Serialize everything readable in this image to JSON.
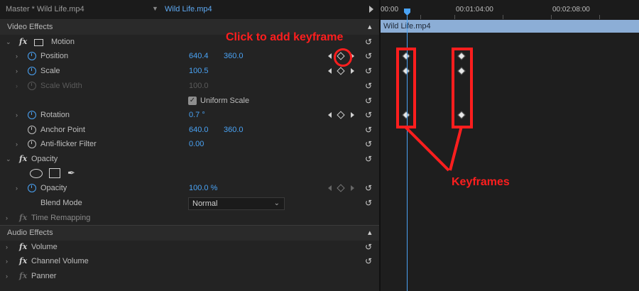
{
  "header": {
    "master_label": "Master * Wild Life.mp4",
    "clip_label": "Wild Life.mp4",
    "chevron_icon": "chevron-down-icon",
    "play_icon": "play-triangle-icon"
  },
  "sections": {
    "video_effects": "Video Effects",
    "audio_effects": "Audio Effects"
  },
  "motion": {
    "label": "Motion",
    "position": {
      "label": "Position",
      "x": "640.4",
      "y": "360.0"
    },
    "scale": {
      "label": "Scale",
      "value": "100.5"
    },
    "scale_width": {
      "label": "Scale Width",
      "value": "100.0"
    },
    "uniform_scale": {
      "label": "Uniform Scale",
      "checked": true
    },
    "rotation": {
      "label": "Rotation",
      "value": "0.7 °"
    },
    "anchor_point": {
      "label": "Anchor Point",
      "x": "640.0",
      "y": "360.0"
    },
    "anti_flicker": {
      "label": "Anti-flicker Filter",
      "value": "0.00"
    }
  },
  "opacity": {
    "label": "Opacity",
    "opacity": {
      "label": "Opacity",
      "value": "100.0 %"
    },
    "blend_mode": {
      "label": "Blend Mode",
      "value": "Normal"
    }
  },
  "time_remapping": {
    "label": "Time Remapping"
  },
  "audio": {
    "volume": "Volume",
    "channel_volume": "Channel Volume",
    "panner": "Panner"
  },
  "timeline": {
    "ticks": [
      "00:00",
      "00:01:04:00",
      "00:02:08:00"
    ],
    "clip_name": "Wild Life.mp4"
  },
  "annotations": {
    "add_keyframe": "Click to add keyframe",
    "keyframes": "Keyframes"
  },
  "colors": {
    "accent_blue": "#4aa3f5",
    "annotation_red": "#ff1e1e",
    "clip_bar": "#8caed6"
  }
}
